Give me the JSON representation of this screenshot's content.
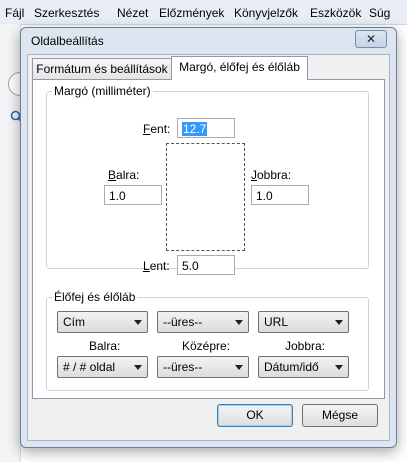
{
  "menubar": {
    "items": [
      "Fájl",
      "Szerkesztés",
      "Nézet",
      "Előzmények",
      "Könyvjelzők",
      "Eszközök",
      "Súg"
    ]
  },
  "dialog": {
    "title": "Oldalbeállítás",
    "close_glyph": "✕",
    "tabs": [
      "Formátum és beállítások",
      "Margó, élőfej és élőláb"
    ],
    "active_tab": 1,
    "margins": {
      "group_label": "Margó (milliméter)",
      "top_label": "Fent:",
      "top_value": "12.7",
      "left_label": "Balra:",
      "left_value": "1.0",
      "right_label": "Jobbra:",
      "right_value": "1.0",
      "bottom_label": "Lent:",
      "bottom_value": "5.0"
    },
    "header_footer": {
      "group_label": "Élőfej és élőláb",
      "header_left": "Cím",
      "header_center": "--üres--",
      "header_right": "URL",
      "left_label": "Balra:",
      "center_label": "Középre:",
      "right_label": "Jobbra:",
      "footer_left": "# / # oldal",
      "footer_center": "--üres--",
      "footer_right": "Dátum/idő"
    },
    "ok_label": "OK",
    "cancel_label": "Mégse"
  },
  "colors": {
    "selection": "#3399ff",
    "dialog_frame": "#dde5f1"
  }
}
